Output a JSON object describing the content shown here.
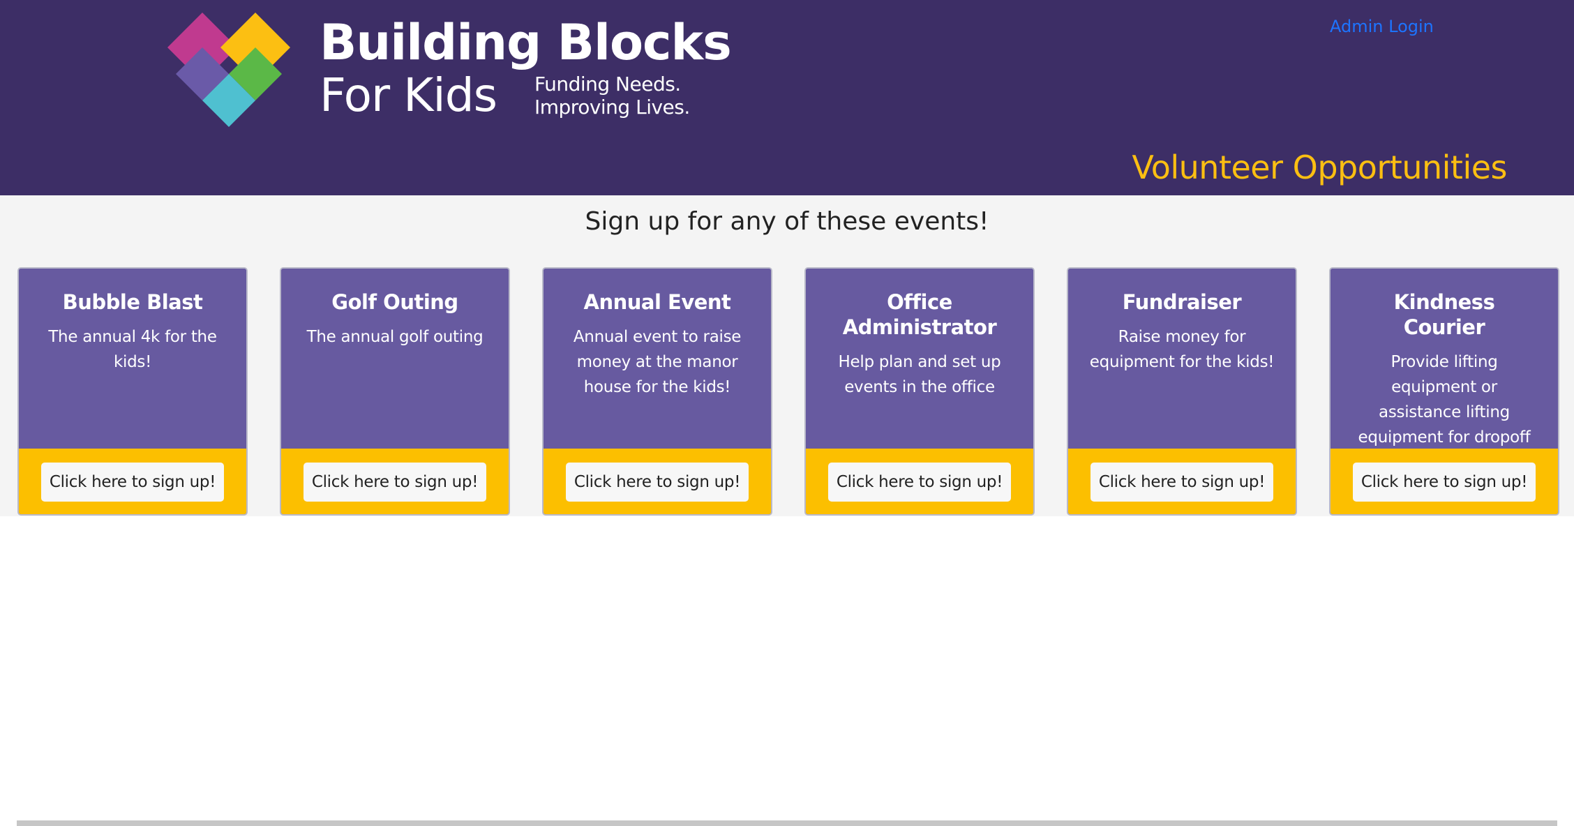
{
  "header": {
    "brand_line1": "Building Blocks",
    "brand_line2": "For Kids",
    "tagline_line1": "Funding Needs.",
    "tagline_line2": "Improving Lives.",
    "admin_login": "Admin Login",
    "page_title": "Volunteer Opportunities"
  },
  "main": {
    "subheading": "Sign up for any of these events!",
    "cards": [
      {
        "title": "Bubble Blast",
        "description": "The annual 4k for the kids!",
        "button": "Click here to sign up!"
      },
      {
        "title": "Golf Outing",
        "description": "The annual golf outing",
        "button": "Click here to sign up!"
      },
      {
        "title": "Annual Event",
        "description": "Annual event to raise money at the manor house for the kids!",
        "button": "Click here to sign up!"
      },
      {
        "title": "Office Administrator",
        "description": "Help plan and set up events in the office",
        "button": "Click here to sign up!"
      },
      {
        "title": "Fundraiser",
        "description": "Raise money for equipment for the kids!",
        "button": "Click here to sign up!"
      },
      {
        "title": "Kindness Courier",
        "description": "Provide lifting equipment or assistance lifting equipment for dropoff",
        "button": "Click here to sign up!"
      }
    ]
  },
  "colors": {
    "header_bg": "#3d2e66",
    "accent_yellow": "#fcbf12",
    "card_purple": "#675aa0",
    "link_blue": "#1d74ff",
    "logo_magenta": "#c03a8f",
    "logo_yellow": "#fcbf12",
    "logo_green": "#5bb847",
    "logo_cyan": "#4fc0d0",
    "logo_violet": "#6a5aa8"
  }
}
